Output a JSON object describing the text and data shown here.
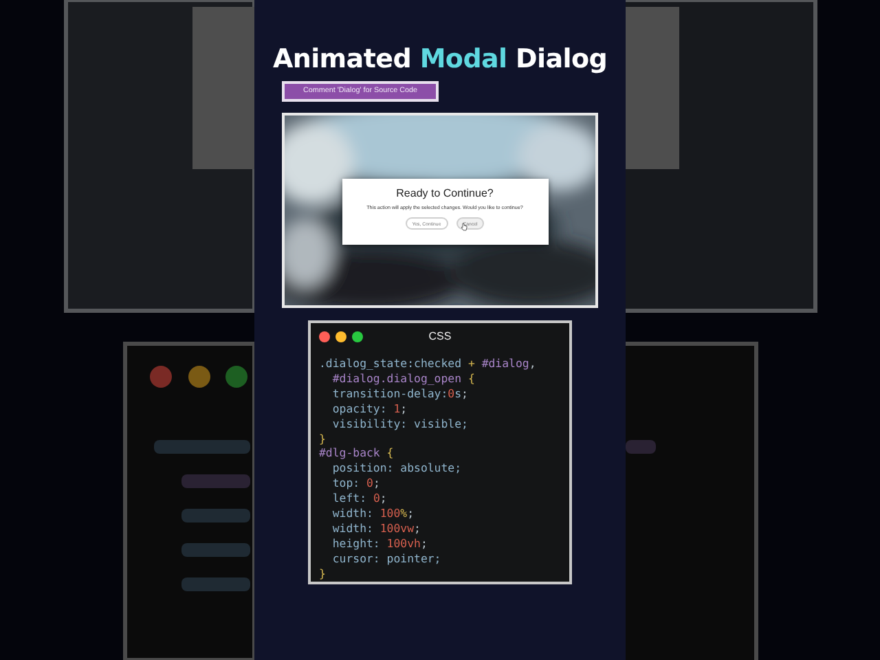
{
  "title": [
    {
      "text": "Animated ",
      "accent": false
    },
    {
      "text": "Modal",
      "accent": true
    },
    {
      "text": " Dialog",
      "accent": false
    }
  ],
  "cta": {
    "label": "Comment 'Dialog' for Source Code"
  },
  "preview": {
    "dialog": {
      "title": "Ready to Continue?",
      "message": "This action will apply the selected changes. Would you like to continue?",
      "buttons": [
        {
          "label": "Yes, Continue",
          "hovered": false
        },
        {
          "label": "Cancel",
          "hovered": true
        }
      ]
    }
  },
  "code_window": {
    "title": "CSS",
    "lines": [
      [
        {
          "t": ".dialog_state:checked",
          "kind": "sel"
        },
        {
          "t": " + ",
          "kind": "op"
        },
        {
          "t": "#dialog",
          "kind": "id"
        },
        {
          "t": ",",
          "kind": "punct"
        }
      ],
      [
        {
          "t": "  #dialog.dialog_open",
          "kind": "id"
        },
        {
          "t": " {",
          "kind": "op"
        }
      ],
      [
        {
          "t": "  transition-delay:",
          "kind": "prop"
        },
        {
          "t": "0",
          "kind": "num"
        },
        {
          "t": "s",
          "kind": "prop"
        },
        {
          "t": ";",
          "kind": "punct"
        }
      ],
      [
        {
          "t": "  opacity: ",
          "kind": "prop"
        },
        {
          "t": "1",
          "kind": "num"
        },
        {
          "t": ";",
          "kind": "punct"
        }
      ],
      [
        {
          "t": "  visibility: visible;",
          "kind": "prop"
        }
      ],
      [
        {
          "t": "}",
          "kind": "op"
        }
      ],
      [
        {
          "t": "#dlg-back",
          "kind": "id"
        },
        {
          "t": " {",
          "kind": "op"
        }
      ],
      [
        {
          "t": "  position: absolute;",
          "kind": "prop"
        }
      ],
      [
        {
          "t": "  top: ",
          "kind": "prop"
        },
        {
          "t": "0",
          "kind": "num"
        },
        {
          "t": ";",
          "kind": "punct"
        }
      ],
      [
        {
          "t": "  left: ",
          "kind": "prop"
        },
        {
          "t": "0",
          "kind": "num"
        },
        {
          "t": ";",
          "kind": "punct"
        }
      ],
      [
        {
          "t": "  width: ",
          "kind": "prop"
        },
        {
          "t": "100",
          "kind": "num"
        },
        {
          "t": "%",
          "kind": "op"
        },
        {
          "t": ";",
          "kind": "punct"
        }
      ],
      [
        {
          "t": "  width: ",
          "kind": "prop"
        },
        {
          "t": "100vw",
          "kind": "num"
        },
        {
          "t": ";",
          "kind": "punct"
        }
      ],
      [
        {
          "t": "  height: ",
          "kind": "prop"
        },
        {
          "t": "100vh",
          "kind": "num"
        },
        {
          "t": ";",
          "kind": "punct"
        }
      ],
      [
        {
          "t": "  cursor: pointer;",
          "kind": "prop"
        }
      ],
      [
        {
          "t": "}",
          "kind": "op"
        }
      ]
    ]
  }
}
